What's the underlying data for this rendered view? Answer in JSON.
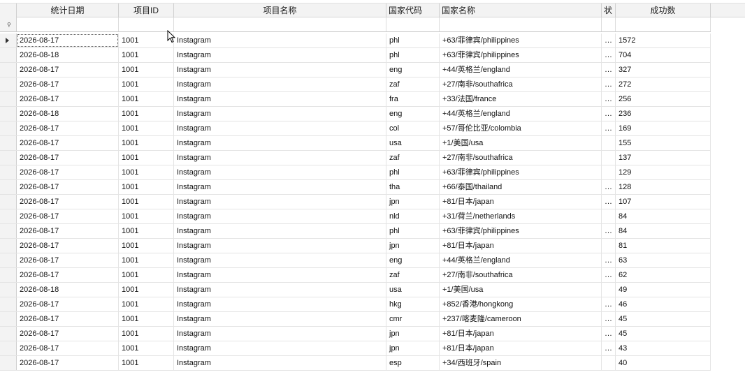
{
  "columns": [
    "统计日期",
    "项目ID",
    "项目名称",
    "国家代码",
    "国家名称",
    "状",
    "成功数"
  ],
  "rows": [
    {
      "date": "2026-08-17",
      "pid": "1001",
      "pname": "Instagram",
      "code": "phl",
      "country": "+63/菲律宾/philippines",
      "status": "…",
      "count": "1572"
    },
    {
      "date": "2026-08-18",
      "pid": "1001",
      "pname": "Instagram",
      "code": "phl",
      "country": "+63/菲律宾/philippines",
      "status": "…",
      "count": "704"
    },
    {
      "date": "2026-08-17",
      "pid": "1001",
      "pname": "Instagram",
      "code": "eng",
      "country": "+44/英格兰/england",
      "status": "…",
      "count": "327"
    },
    {
      "date": "2026-08-17",
      "pid": "1001",
      "pname": "Instagram",
      "code": "zaf",
      "country": "+27/南非/southafrica",
      "status": "…",
      "count": "272"
    },
    {
      "date": "2026-08-17",
      "pid": "1001",
      "pname": "Instagram",
      "code": "fra",
      "country": "+33/法国/france",
      "status": "…",
      "count": "256"
    },
    {
      "date": "2026-08-18",
      "pid": "1001",
      "pname": "Instagram",
      "code": "eng",
      "country": "+44/英格兰/england",
      "status": "…",
      "count": "236"
    },
    {
      "date": "2026-08-17",
      "pid": "1001",
      "pname": "Instagram",
      "code": "col",
      "country": "+57/哥伦比亚/colombia",
      "status": "…",
      "count": "169"
    },
    {
      "date": "2026-08-17",
      "pid": "1001",
      "pname": "Instagram",
      "code": "usa",
      "country": "+1/美国/usa",
      "status": "",
      "count": "155"
    },
    {
      "date": "2026-08-17",
      "pid": "1001",
      "pname": "Instagram",
      "code": "zaf",
      "country": "+27/南非/southafrica",
      "status": "",
      "count": "137"
    },
    {
      "date": "2026-08-17",
      "pid": "1001",
      "pname": "Instagram",
      "code": "phl",
      "country": "+63/菲律宾/philippines",
      "status": "",
      "count": "129"
    },
    {
      "date": "2026-08-17",
      "pid": "1001",
      "pname": "Instagram",
      "code": "tha",
      "country": "+66/泰国/thailand",
      "status": "…",
      "count": "128"
    },
    {
      "date": "2026-08-17",
      "pid": "1001",
      "pname": "Instagram",
      "code": "jpn",
      "country": "+81/日本/japan",
      "status": "…",
      "count": "107"
    },
    {
      "date": "2026-08-17",
      "pid": "1001",
      "pname": "Instagram",
      "code": "nld",
      "country": "+31/荷兰/netherlands",
      "status": "",
      "count": "84"
    },
    {
      "date": "2026-08-17",
      "pid": "1001",
      "pname": "Instagram",
      "code": "phl",
      "country": "+63/菲律宾/philippines",
      "status": "…",
      "count": "84"
    },
    {
      "date": "2026-08-17",
      "pid": "1001",
      "pname": "Instagram",
      "code": "jpn",
      "country": "+81/日本/japan",
      "status": "",
      "count": "81"
    },
    {
      "date": "2026-08-17",
      "pid": "1001",
      "pname": "Instagram",
      "code": "eng",
      "country": "+44/英格兰/england",
      "status": "…",
      "count": "63"
    },
    {
      "date": "2026-08-17",
      "pid": "1001",
      "pname": "Instagram",
      "code": "zaf",
      "country": "+27/南非/southafrica",
      "status": "…",
      "count": "62"
    },
    {
      "date": "2026-08-18",
      "pid": "1001",
      "pname": "Instagram",
      "code": "usa",
      "country": "+1/美国/usa",
      "status": "",
      "count": "49"
    },
    {
      "date": "2026-08-17",
      "pid": "1001",
      "pname": "Instagram",
      "code": "hkg",
      "country": "+852/香港/hongkong",
      "status": "…",
      "count": "46"
    },
    {
      "date": "2026-08-17",
      "pid": "1001",
      "pname": "Instagram",
      "code": "cmr",
      "country": "+237/喀麦隆/cameroon",
      "status": "…",
      "count": "45"
    },
    {
      "date": "2026-08-17",
      "pid": "1001",
      "pname": "Instagram",
      "code": "jpn",
      "country": "+81/日本/japan",
      "status": "…",
      "count": "45"
    },
    {
      "date": "2026-08-17",
      "pid": "1001",
      "pname": "Instagram",
      "code": "jpn",
      "country": "+81/日本/japan",
      "status": "…",
      "count": "43"
    },
    {
      "date": "2026-08-17",
      "pid": "1001",
      "pname": "Instagram",
      "code": "esp",
      "country": "+34/西班牙/spain",
      "status": "",
      "count": "40"
    }
  ]
}
